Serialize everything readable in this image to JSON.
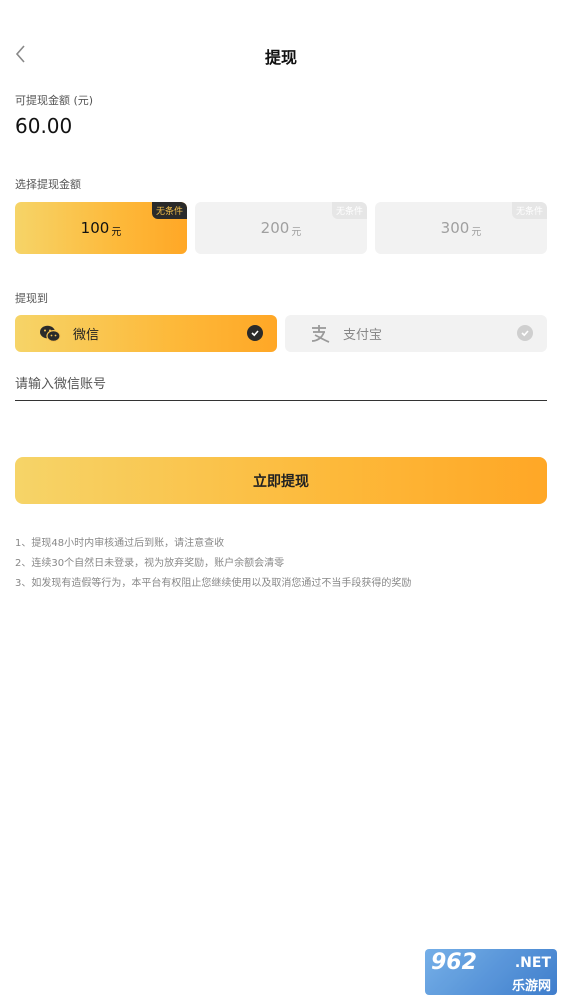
{
  "header": {
    "title": "提现"
  },
  "balance": {
    "label": "可提现金额 (元)",
    "value": "60.00"
  },
  "amount_section": {
    "label": "选择提现金额",
    "options": [
      {
        "value": "100",
        "unit": "元",
        "tag": "无条件",
        "selected": true
      },
      {
        "value": "200",
        "unit": "元",
        "tag": "无条件",
        "selected": false
      },
      {
        "value": "300",
        "unit": "元",
        "tag": "无条件",
        "selected": false
      }
    ]
  },
  "method_section": {
    "label": "提现到",
    "options": [
      {
        "label": "微信",
        "icon": "wechat-icon",
        "selected": true
      },
      {
        "label": "支付宝",
        "icon": "alipay-icon",
        "selected": false
      }
    ]
  },
  "account": {
    "placeholder": "请输入微信账号",
    "value": ""
  },
  "submit": {
    "label": "立即提现"
  },
  "notes": [
    "1、提现48小时内审核通过后到账，请注意查收",
    "2、连续30个自然日未登录，视为放弃奖励，账户余额会清零",
    "3、如发现有造假等行为，本平台有权阻止您继续使用以及取消您通过不当手段获得的奖励"
  ],
  "watermark": {
    "brand": "962",
    "domain": ".NET",
    "name": "乐游网"
  },
  "colors": {
    "accent_start": "#f6d468",
    "accent_end": "#ffa726",
    "muted_bg": "#f2f2f2"
  }
}
